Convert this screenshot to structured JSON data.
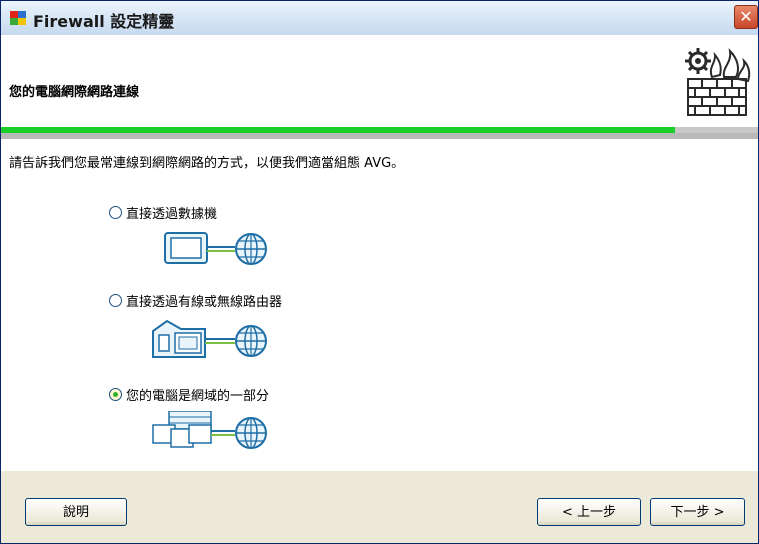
{
  "window": {
    "title": "Firewall 設定精靈",
    "close_glyph": "✕"
  },
  "header": {
    "title": "您的電腦網際網路連線",
    "icon": "gear-fire-brick-wall-icon"
  },
  "progress": {
    "value": 0.89,
    "color": "#1bcf2b"
  },
  "main": {
    "instruction": "請告訴我們您最常連線到網際網路的方式，以便我們適當組態 AVG。",
    "options": [
      {
        "label": "直接透過數據機",
        "checked": false,
        "icon": "monitor-globe-icon"
      },
      {
        "label": "直接透過有線或無線路由器",
        "checked": false,
        "icon": "house-computer-globe-icon"
      },
      {
        "label": "您的電腦是網域的一部分",
        "checked": true,
        "icon": "network-computers-globe-icon"
      }
    ]
  },
  "footer": {
    "help": "說明",
    "back": "< 上一步",
    "next": "下一步 >"
  }
}
